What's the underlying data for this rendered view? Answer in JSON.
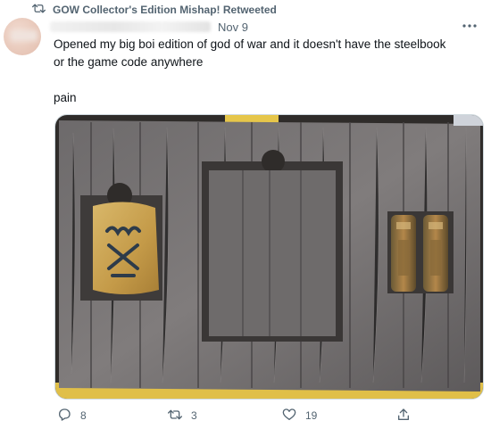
{
  "retweet_banner": {
    "text": "GOW Collector's Edition Mishap! Retweeted"
  },
  "tweet": {
    "date": "Nov 9",
    "text": "Opened my big boi edition of god of war and it doesn't have the steelbook\nor the game code anywhere\n\npain"
  },
  "actions": {
    "reply_count": "8",
    "retweet_count": "3",
    "like_count": "19"
  }
}
